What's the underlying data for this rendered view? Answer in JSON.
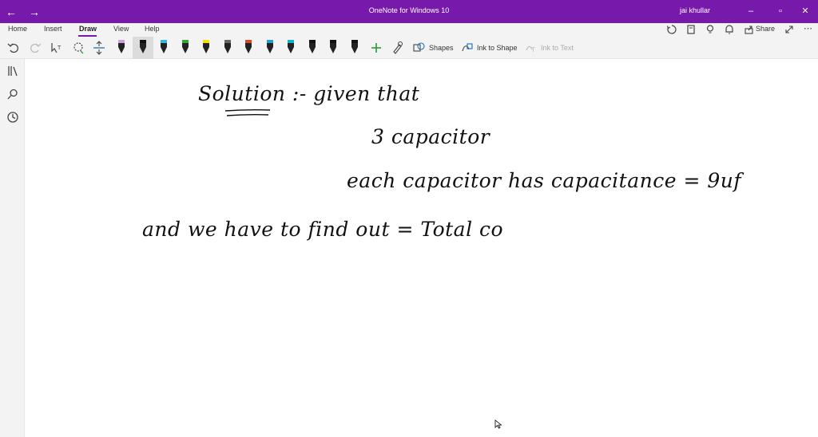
{
  "window": {
    "title": "OneNote for Windows 10",
    "user": "jai khullar",
    "colors": {
      "titlebar": "#7719aa",
      "ribbon": "#f3f3f3"
    }
  },
  "tabs": [
    {
      "label": "Home"
    },
    {
      "label": "Insert"
    },
    {
      "label": "Draw",
      "active": true
    },
    {
      "label": "View"
    },
    {
      "label": "Help"
    }
  ],
  "ribbon_right": {
    "share_label": "Share"
  },
  "toolbar": {
    "shapes_label": "Shapes",
    "ink_to_shape_label": "Ink to Shape",
    "ink_to_text_label": "Ink to Text",
    "pen_colors": [
      "#c9a0dc",
      "#111111",
      "#2fb7e6",
      "#3aa23a",
      "#f5e100",
      "#666666",
      "#d44a2a",
      "#1f9fd8",
      "#0fb0c8",
      "#111111",
      "#111111",
      "#111111"
    ]
  },
  "note": {
    "line1": "Solution :-  given that",
    "line2": "3 capacitor",
    "line3": "each capacitor has capacitance = 9uf",
    "line4": "and  we have to find out  =  Total  co"
  }
}
